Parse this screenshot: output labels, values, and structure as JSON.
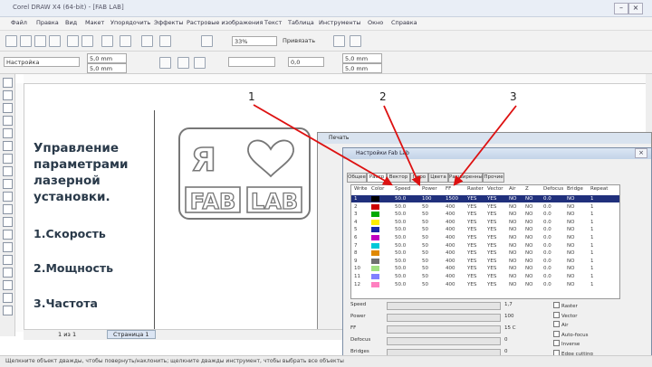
{
  "window": {
    "title": "Corel DRAW X4 (64-bit) - [FAB LAB]"
  },
  "menu": [
    "Файл",
    "Правка",
    "Вид",
    "Макет",
    "Упорядочить",
    "Эффекты",
    "Растровые изображения",
    "Текст",
    "Таблица",
    "Инструменты",
    "Окно",
    "Справка"
  ],
  "toolbar": {
    "zoom": "33%",
    "snap": "Привязать",
    "font_field": "Настройка",
    "width1": "5,0 mm",
    "width2": "5,0 mm",
    "offset": "0,0"
  },
  "slide": {
    "heading": "Управление параметрами лазерной установки.",
    "items": [
      "1.Скорость",
      "2.Мощность",
      "3.Частота"
    ],
    "callouts": [
      "1",
      "2",
      "3"
    ]
  },
  "logo": {
    "top_left": "Я",
    "bottom_left": "FAB",
    "bottom_right": "LAB"
  },
  "dialog": {
    "back_title": "Печать",
    "title": "Настройки Fab Lab",
    "tabs": [
      "Общее",
      "Растр",
      "Вектор",
      "Перо",
      "Цвета",
      "Расширенные",
      "Прочие"
    ],
    "columns": [
      "Write",
      "Color",
      "Speed",
      "Power",
      "FF",
      "Raster",
      "Vector",
      "Air",
      "Z",
      "Defocus",
      "Bridge",
      "Repeat"
    ],
    "rows": [
      [
        "1",
        "#000000",
        "50.0",
        "100",
        "1500",
        "YES",
        "YES",
        "NO",
        "NO",
        "0.0",
        "NO",
        "1"
      ],
      [
        "2",
        "#cc0000",
        "50.0",
        "50",
        "400",
        "YES",
        "YES",
        "NO",
        "NO",
        "0.0",
        "NO",
        "1"
      ],
      [
        "3",
        "#00aa00",
        "50.0",
        "50",
        "400",
        "YES",
        "YES",
        "NO",
        "NO",
        "0.0",
        "NO",
        "1"
      ],
      [
        "4",
        "#ffee00",
        "50.0",
        "50",
        "400",
        "YES",
        "YES",
        "NO",
        "NO",
        "0.0",
        "NO",
        "1"
      ],
      [
        "5",
        "#1a2aa8",
        "50.0",
        "50",
        "400",
        "YES",
        "YES",
        "NO",
        "NO",
        "0.0",
        "NO",
        "1"
      ],
      [
        "6",
        "#c000c0",
        "50.0",
        "50",
        "400",
        "YES",
        "YES",
        "NO",
        "NO",
        "0.0",
        "NO",
        "1"
      ],
      [
        "7",
        "#00c8d8",
        "50.0",
        "50",
        "400",
        "YES",
        "YES",
        "NO",
        "NO",
        "0.0",
        "NO",
        "1"
      ],
      [
        "8",
        "#e08800",
        "50.0",
        "50",
        "400",
        "YES",
        "YES",
        "NO",
        "NO",
        "0.0",
        "NO",
        "1"
      ],
      [
        "9",
        "#707070",
        "50.0",
        "50",
        "400",
        "YES",
        "YES",
        "NO",
        "NO",
        "0.0",
        "NO",
        "1"
      ],
      [
        "10",
        "#a0e080",
        "50.0",
        "50",
        "400",
        "YES",
        "YES",
        "NO",
        "NO",
        "0.0",
        "NO",
        "1"
      ],
      [
        "11",
        "#8080ff",
        "50.0",
        "50",
        "400",
        "YES",
        "YES",
        "NO",
        "NO",
        "0.0",
        "NO",
        "1"
      ],
      [
        "12",
        "#ff80c0",
        "50.0",
        "50",
        "400",
        "YES",
        "YES",
        "NO",
        "NO",
        "0.0",
        "NO",
        "1"
      ]
    ],
    "params": [
      {
        "label": "Speed",
        "value": "1,7"
      },
      {
        "label": "Power",
        "value": "100"
      },
      {
        "label": "FF",
        "value": "15 C"
      },
      {
        "label": "Defocus",
        "value": "0"
      },
      {
        "label": "Bridges",
        "value": "0"
      }
    ],
    "options": [
      "Raster",
      "Vector",
      "Air",
      "Auto-focus",
      "Inverse",
      "Edge cutting"
    ]
  },
  "pagebar": {
    "counter": "1 из 1",
    "page_tab": "Страница 1"
  },
  "status": "Щелкните объект дважды, чтобы повернуть/наклонить; щелкните дважды инструмент, чтобы выбрать все объекты"
}
